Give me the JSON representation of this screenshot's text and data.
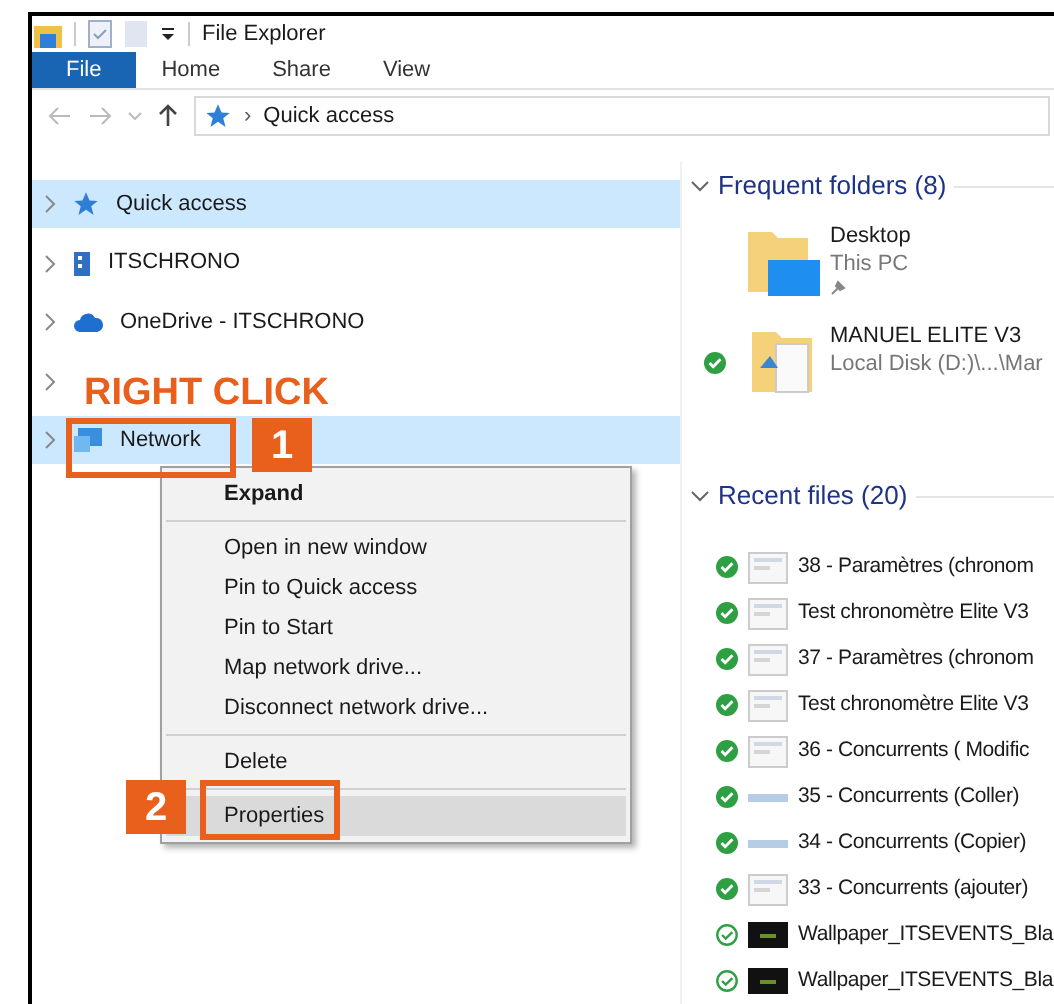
{
  "window": {
    "title": "File Explorer"
  },
  "ribbon_tabs": [
    {
      "label": "File",
      "kind": "file"
    },
    {
      "label": "Home",
      "kind": "tab"
    },
    {
      "label": "Share",
      "kind": "tab"
    },
    {
      "label": "View",
      "kind": "tab"
    }
  ],
  "address_bar": {
    "separator": "›",
    "path": "Quick access"
  },
  "navigation": [
    {
      "label": "Quick access",
      "kind": "quick_access",
      "selected": true
    },
    {
      "label": "ITSCHRONO",
      "kind": "computer",
      "selected": false
    },
    {
      "label": "OneDrive - ITSCHRONO",
      "kind": "cloud",
      "selected": false
    },
    {
      "kind": "hidden",
      "selected": false
    },
    {
      "label": "Network",
      "kind": "network",
      "selected": true
    }
  ],
  "context_menu": [
    {
      "label": "Expand",
      "kind": "default",
      "selected": false
    },
    {
      "kind": "separator"
    },
    {
      "label": "Open in new window",
      "kind": "item",
      "selected": false
    },
    {
      "label": "Pin to Quick access",
      "kind": "item",
      "selected": false
    },
    {
      "label": "Pin to Start",
      "kind": "item",
      "selected": false
    },
    {
      "label": "Map network drive...",
      "kind": "item",
      "selected": false
    },
    {
      "label": "Disconnect network drive...",
      "kind": "item",
      "selected": false
    },
    {
      "kind": "separator"
    },
    {
      "label": "Delete",
      "kind": "item",
      "selected": false
    },
    {
      "kind": "separator"
    },
    {
      "label": "Properties",
      "kind": "item",
      "selected": true
    }
  ],
  "annotations": {
    "instruction": "RIGHT CLICK",
    "step_1": "1",
    "step_2": "2"
  },
  "frequent_folders": {
    "title": "Frequent folders (8)",
    "items": [
      {
        "name": "Desktop",
        "location": "This PC",
        "kind": "desktop",
        "pinned": true,
        "synced": false
      },
      {
        "name": "MANUEL ELITE V3",
        "location": "Local Disk (D:)\\...\\Mar",
        "kind": "documents",
        "pinned": false,
        "synced": true
      }
    ]
  },
  "recent_files": {
    "title": "Recent files (20)",
    "items": [
      {
        "name": "38 - Paramètres (chronom",
        "kind": "synced"
      },
      {
        "name": "Test chronomètre Elite V3",
        "kind": "synced"
      },
      {
        "name": "37 - Paramètres (chronom",
        "kind": "synced"
      },
      {
        "name": "Test chronomètre Elite V3",
        "kind": "synced"
      },
      {
        "name": "36 - Concurrents ( Modific",
        "kind": "synced"
      },
      {
        "name": "35 - Concurrents (Coller)",
        "kind": "synced"
      },
      {
        "name": "34 - Concurrents (Copier)",
        "kind": "synced"
      },
      {
        "name": "33 - Concurrents (ajouter)",
        "kind": "synced"
      },
      {
        "name": "Wallpaper_ITSEVENTS_Bla",
        "kind": "available"
      },
      {
        "name": "Wallpaper_ITSEVENTS_Bla",
        "kind": "available"
      }
    ]
  }
}
